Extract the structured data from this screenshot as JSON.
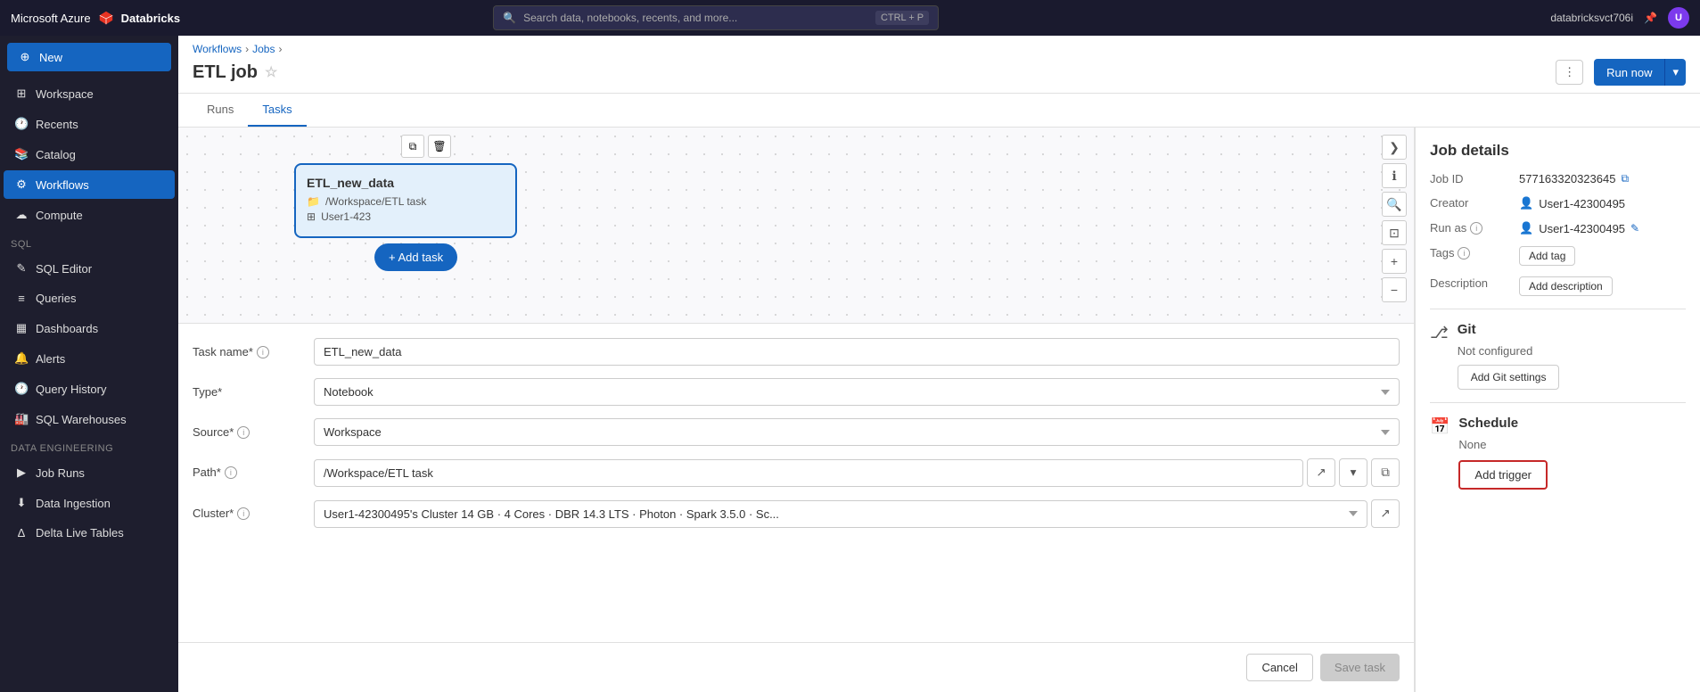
{
  "app": {
    "title": "Databricks",
    "azure_label": "Microsoft Azure"
  },
  "topnav": {
    "search_placeholder": "Search data, notebooks, recents, and more...",
    "search_shortcut": "CTRL + P",
    "user": "databricksvct706i",
    "avatar_initial": "U"
  },
  "sidebar": {
    "new_label": "New",
    "items": [
      {
        "id": "workspace",
        "label": "Workspace",
        "icon": "⊞"
      },
      {
        "id": "recents",
        "label": "Recents",
        "icon": "🕐"
      },
      {
        "id": "catalog",
        "label": "Catalog",
        "icon": "📚"
      },
      {
        "id": "workflows",
        "label": "Workflows",
        "icon": "⚙"
      },
      {
        "id": "compute",
        "label": "Compute",
        "icon": "☁"
      }
    ],
    "sql_section": "SQL",
    "sql_items": [
      {
        "id": "sql-editor",
        "label": "SQL Editor",
        "icon": "✎"
      },
      {
        "id": "queries",
        "label": "Queries",
        "icon": "≡"
      },
      {
        "id": "dashboards",
        "label": "Dashboards",
        "icon": "▦"
      },
      {
        "id": "alerts",
        "label": "Alerts",
        "icon": "🔔"
      },
      {
        "id": "query-history",
        "label": "Query History",
        "icon": "🕐"
      },
      {
        "id": "sql-warehouses",
        "label": "SQL Warehouses",
        "icon": "🏭"
      }
    ],
    "data_eng_section": "Data Engineering",
    "data_eng_items": [
      {
        "id": "job-runs",
        "label": "Job Runs",
        "icon": "▶"
      },
      {
        "id": "data-ingestion",
        "label": "Data Ingestion",
        "icon": "⬇"
      },
      {
        "id": "delta-live-tables",
        "label": "Delta Live Tables",
        "icon": "Δ"
      }
    ]
  },
  "breadcrumb": {
    "items": [
      "Workflows",
      "Jobs"
    ],
    "separator": ">"
  },
  "page": {
    "title": "ETL job",
    "tabs": [
      {
        "id": "runs",
        "label": "Runs"
      },
      {
        "id": "tasks",
        "label": "Tasks"
      }
    ],
    "active_tab": "tasks"
  },
  "header_actions": {
    "more_label": "⋮",
    "run_now_label": "Run now",
    "dropdown_label": "▾"
  },
  "canvas": {
    "task_node": {
      "title": "ETL_new_data",
      "path": "/Workspace/ETL task",
      "user": "User1-423"
    },
    "add_task_label": "+ Add task"
  },
  "form": {
    "task_name_label": "Task name*",
    "task_name_value": "ETL_new_data",
    "type_label": "Type*",
    "type_value": "Notebook",
    "source_label": "Source*",
    "source_value": "Workspace",
    "path_label": "Path*",
    "path_value": "/Workspace/ETL task",
    "cluster_label": "Cluster*",
    "cluster_value": "User1-42300495's Cluster  14 GB · 4 Cores · DBR 14.3 LTS · Photon · Spark 3.5.0 · Sc...",
    "cancel_label": "Cancel",
    "save_label": "Save task"
  },
  "right_panel": {
    "title": "Job details",
    "job_id_label": "Job ID",
    "job_id_value": "577163320323645",
    "creator_label": "Creator",
    "creator_value": "User1-42300495",
    "run_as_label": "Run as",
    "run_as_value": "User1-42300495",
    "tags_label": "Tags",
    "add_tag_label": "Add tag",
    "description_label": "Description",
    "add_description_label": "Add description",
    "git_title": "Git",
    "git_status": "Not configured",
    "add_git_label": "Add Git settings",
    "schedule_title": "Schedule",
    "schedule_value": "None",
    "add_trigger_label": "Add trigger"
  }
}
